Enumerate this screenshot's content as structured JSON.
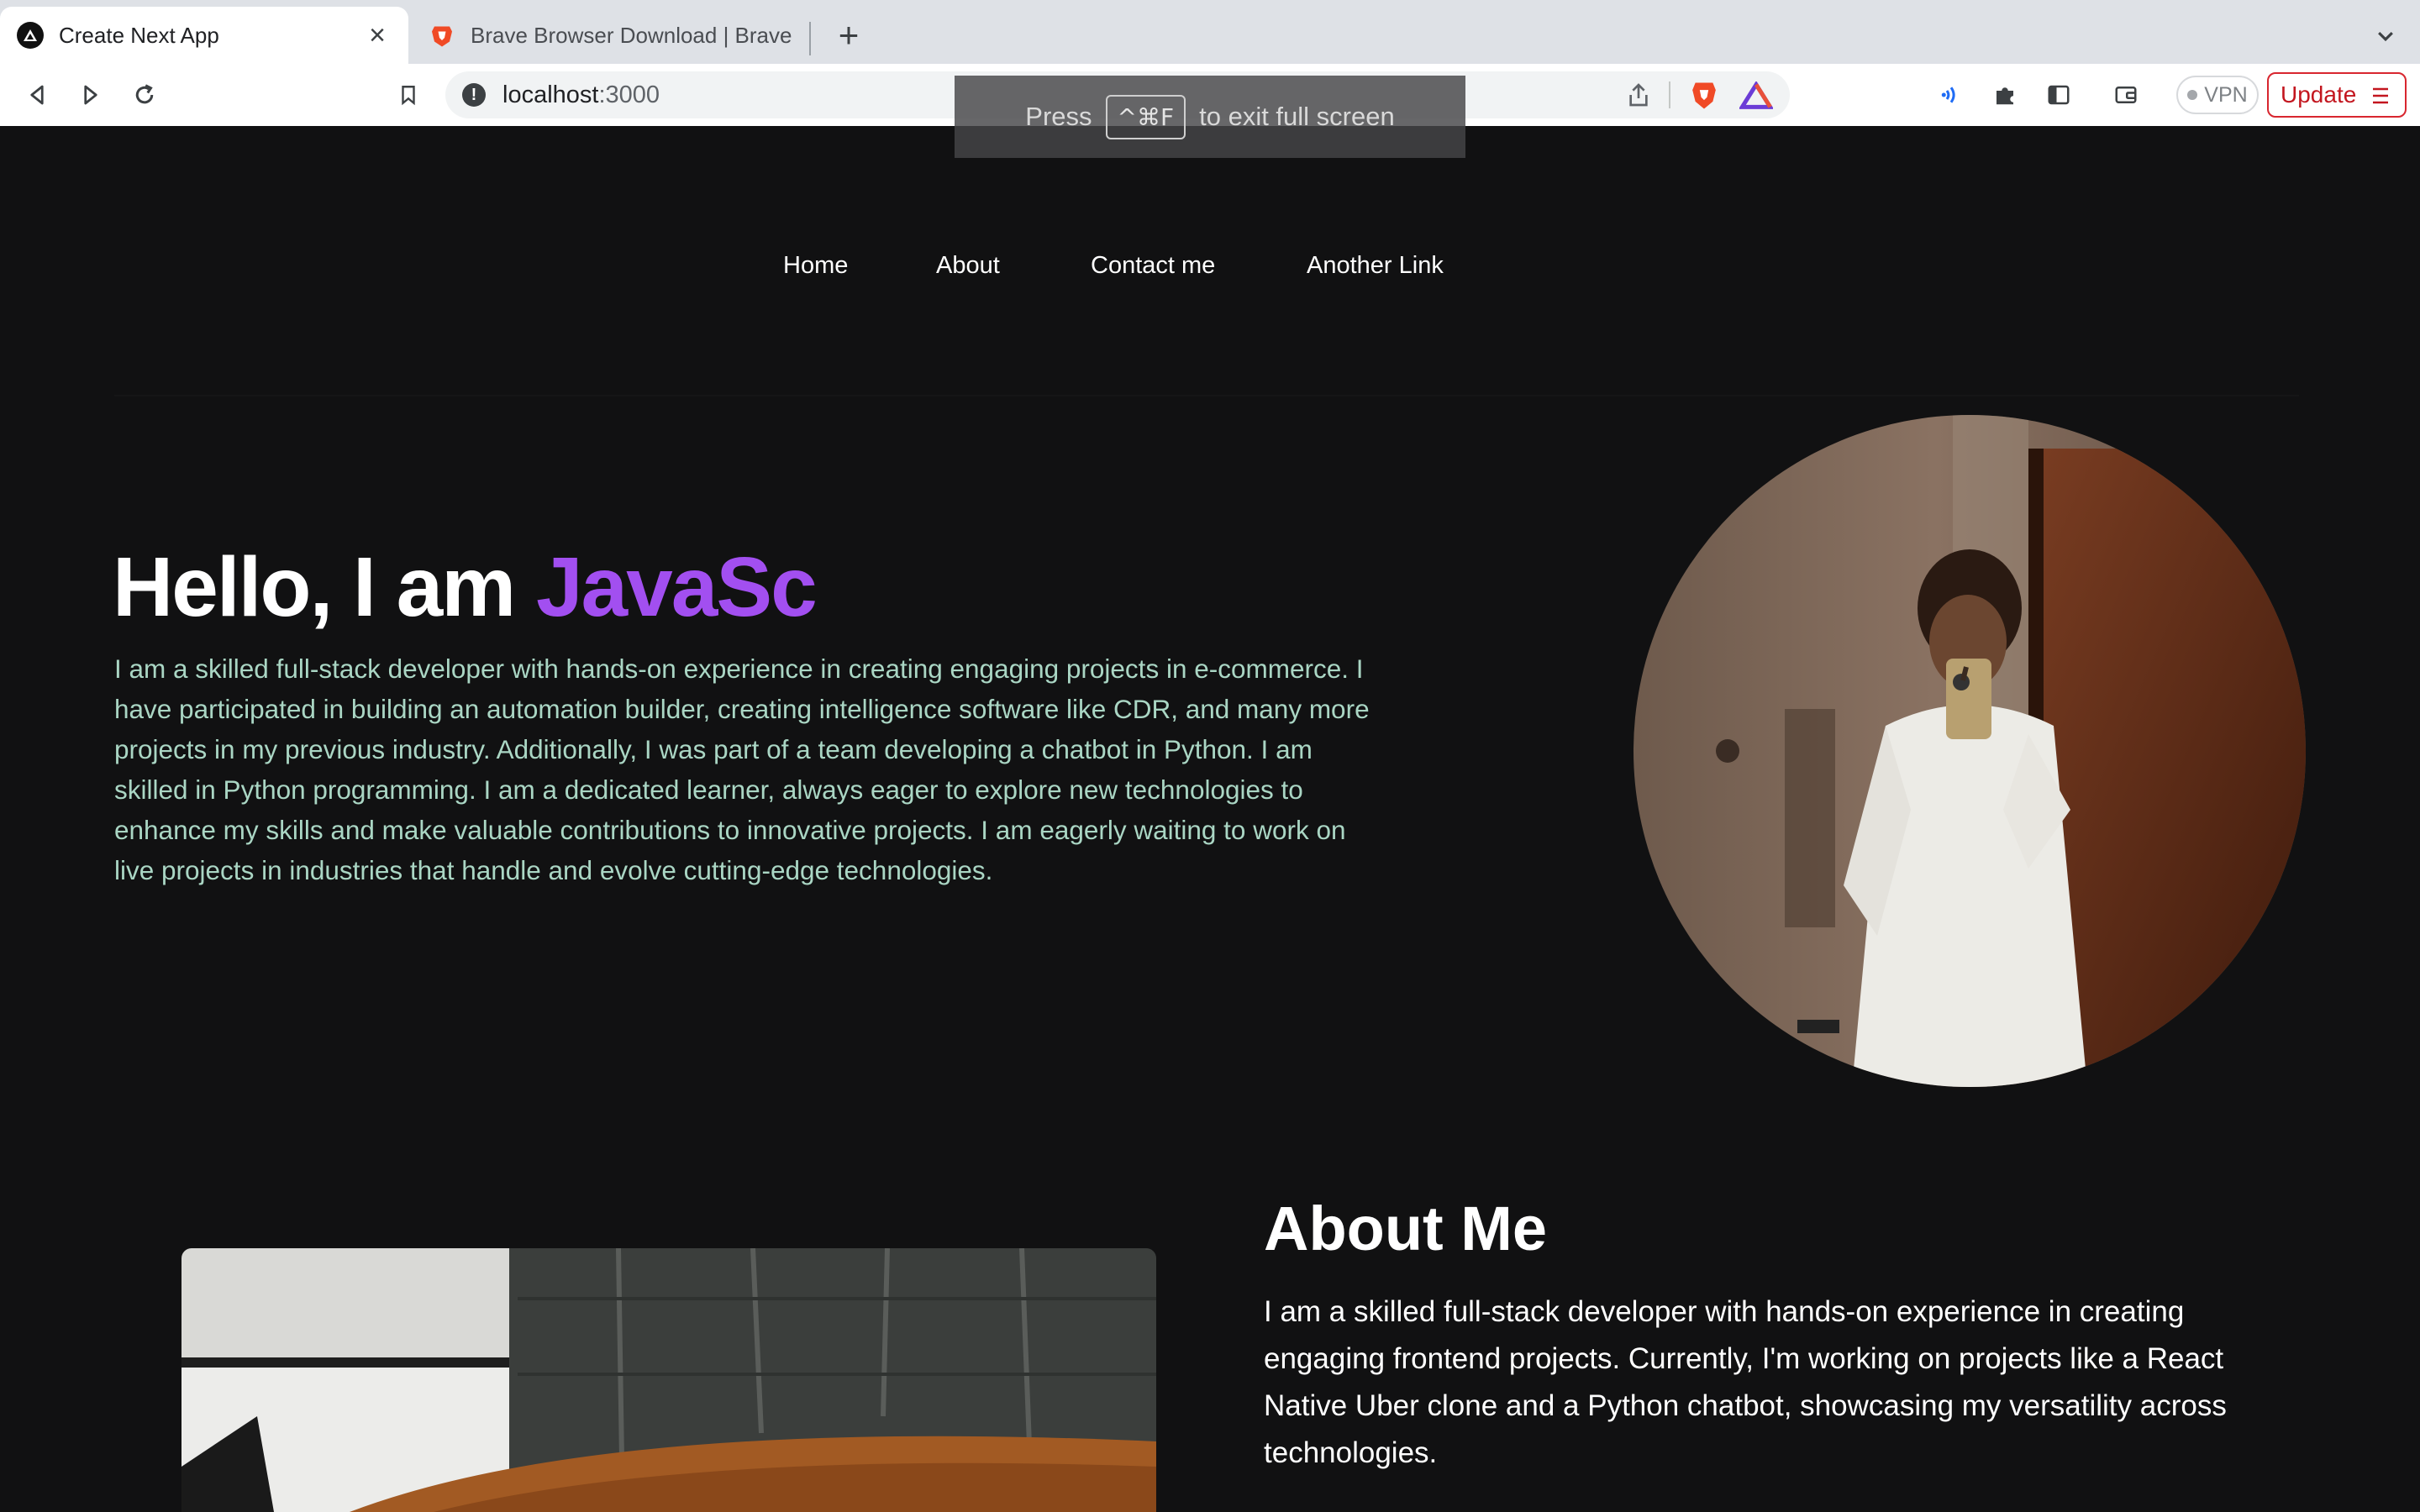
{
  "browser": {
    "tabs": [
      {
        "title": "Create Next App",
        "icon": "nextjs-icon",
        "active": true
      },
      {
        "title": "Brave Browser Download | Brave",
        "icon": "brave-icon",
        "active": false
      }
    ],
    "new_tab_label": "+",
    "address": {
      "host": "localhost",
      "port": ":3000"
    },
    "vpn_label": "VPN",
    "update_label": "Update",
    "fullscreen_notice": {
      "before": "Press",
      "key": "^⌘F",
      "after": "to exit full screen"
    }
  },
  "nav": {
    "links": [
      "Home",
      "About",
      "Contact me",
      "Another Link"
    ]
  },
  "hero": {
    "title_static": "Hello, I am ",
    "title_typed": "JavaSc",
    "bio": "I am a skilled full-stack developer with hands-on experience in creating engaging projects in e-commerce. I have participated in building an automation builder, creating intelligence software like CDR, and many more projects in my previous industry. Additionally, I was part of a team developing a chatbot in Python. I am skilled in Python programming. I am a dedicated learner, always eager to explore new technologies to enhance my skills and make valuable contributions to innovative projects. I am eagerly waiting to work on live projects in industries that handle and evolve cutting-edge technologies."
  },
  "about": {
    "title": "About Me",
    "text": "I am a skilled full-stack developer with hands-on experience in creating engaging frontend projects. Currently, I'm working on projects like a React Native Uber clone and a Python chatbot, showcasing my versatility across technologies."
  },
  "colors": {
    "page_bg": "#111112",
    "accent_purple": "#a24ff0",
    "bio_text": "#aad6c4",
    "update_red": "#d8262f"
  }
}
